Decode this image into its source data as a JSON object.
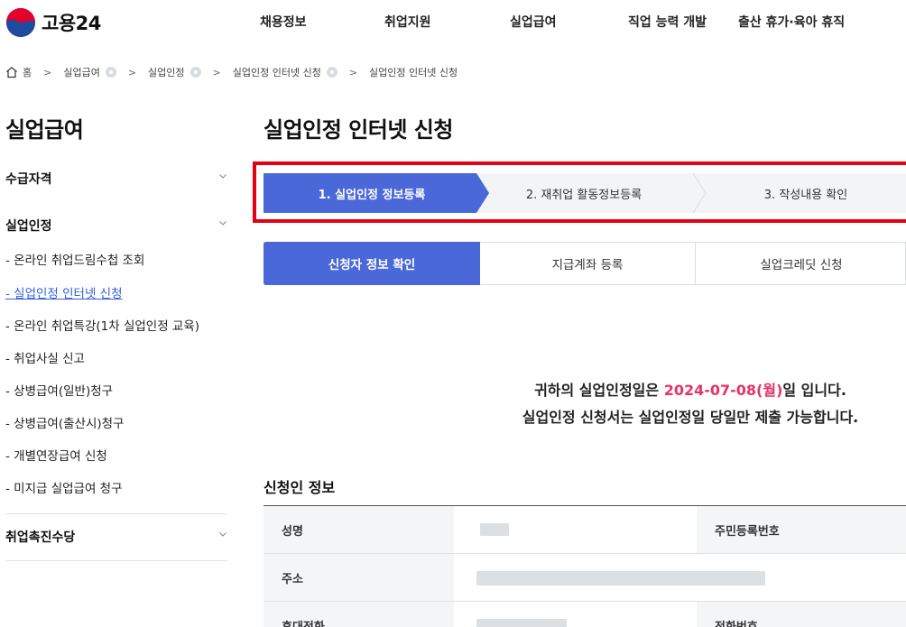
{
  "brand": {
    "name": "고용24"
  },
  "gnb": [
    "채용정보",
    "취업지원",
    "실업급여",
    "직업 능력 개발",
    "출산 휴가·육아 휴직"
  ],
  "breadcrumb": {
    "home": "홈",
    "items": [
      "실업급여",
      "실업인정",
      "실업인정 인터넷 신청",
      "실업인정 인터넷 신청"
    ]
  },
  "sidebar": {
    "title": "실업급여",
    "groups": [
      "수급자격",
      "실업인정",
      "취업촉진수당"
    ],
    "subitems": [
      "- 온라인 취업드림수첩 조회",
      "- 실업인정 인터넷 신청",
      "- 온라인 취업특강(1차 실업인정 교육)",
      "- 취업사실 신고",
      "- 상병급여(일반)청구",
      "- 상병급여(출산시)청구",
      "- 개별연장급여 신청",
      "- 미지급 실업급여 청구"
    ],
    "active_subitem": "- 실업인정 인터넷 신청"
  },
  "page_title": "실업인정 인터넷 신청",
  "steps": [
    "1. 실업인정 정보등록",
    "2. 재취업 활동정보등록",
    "3. 작성내용 확인"
  ],
  "tabs": [
    "신청자 정보 확인",
    "지급계좌 등록",
    "실업크레딧 신청"
  ],
  "notice": {
    "line1_prefix": "귀하의 실업인정일은 ",
    "date": "2024-07-08(월)",
    "line1_suffix": "일 입니다.",
    "line2": "실업인정 신청서는 실업인정일 당일만 제출 가능합니다."
  },
  "applicant": {
    "title": "신청인 정보",
    "labels": {
      "name": "성명",
      "rrn": "주민등록번호",
      "address": "주소",
      "mobile": "휴대전화",
      "phone": "전화번호"
    }
  },
  "colors": {
    "primary": "#4a68d8",
    "highlight": "#e6336a",
    "annotation": "#e60012",
    "active_link": "#3361db"
  },
  "icons": [
    "logo-mark",
    "home-icon",
    "chevron-right-icon",
    "chevron-down-icon"
  ]
}
